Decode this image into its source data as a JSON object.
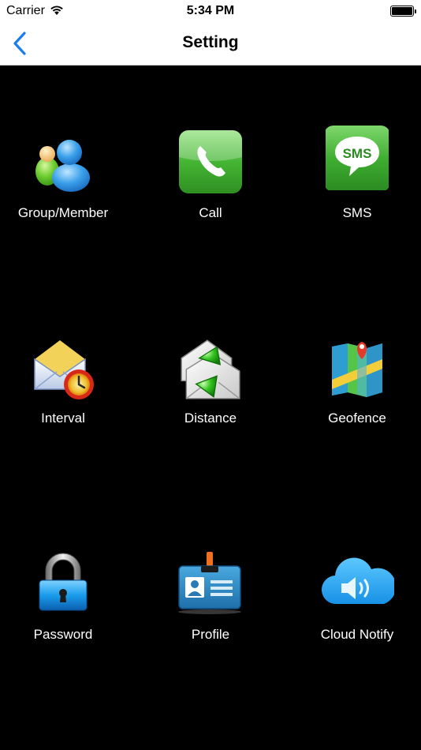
{
  "status_bar": {
    "carrier": "Carrier",
    "time": "5:34 PM"
  },
  "nav": {
    "title": "Setting",
    "back_icon": "chevron-left-icon",
    "accent": "#1a7cf0"
  },
  "menu": [
    {
      "label": "Group/Member",
      "icon": "group-members-icon"
    },
    {
      "label": "Call",
      "icon": "phone-icon"
    },
    {
      "label": "SMS",
      "icon": "sms-icon"
    },
    {
      "label": "Interval",
      "icon": "envelope-clock-icon"
    },
    {
      "label": "Distance",
      "icon": "envelopes-arrows-icon"
    },
    {
      "label": "Geofence",
      "icon": "map-pin-icon"
    },
    {
      "label": "Password",
      "icon": "padlock-icon"
    },
    {
      "label": "Profile",
      "icon": "id-badge-icon"
    },
    {
      "label": "Cloud Notify",
      "icon": "cloud-speaker-icon"
    }
  ],
  "colors": {
    "background": "#000000",
    "label": "#ffffff",
    "green": "#3fb03a",
    "blue": "#2b8fd8"
  }
}
